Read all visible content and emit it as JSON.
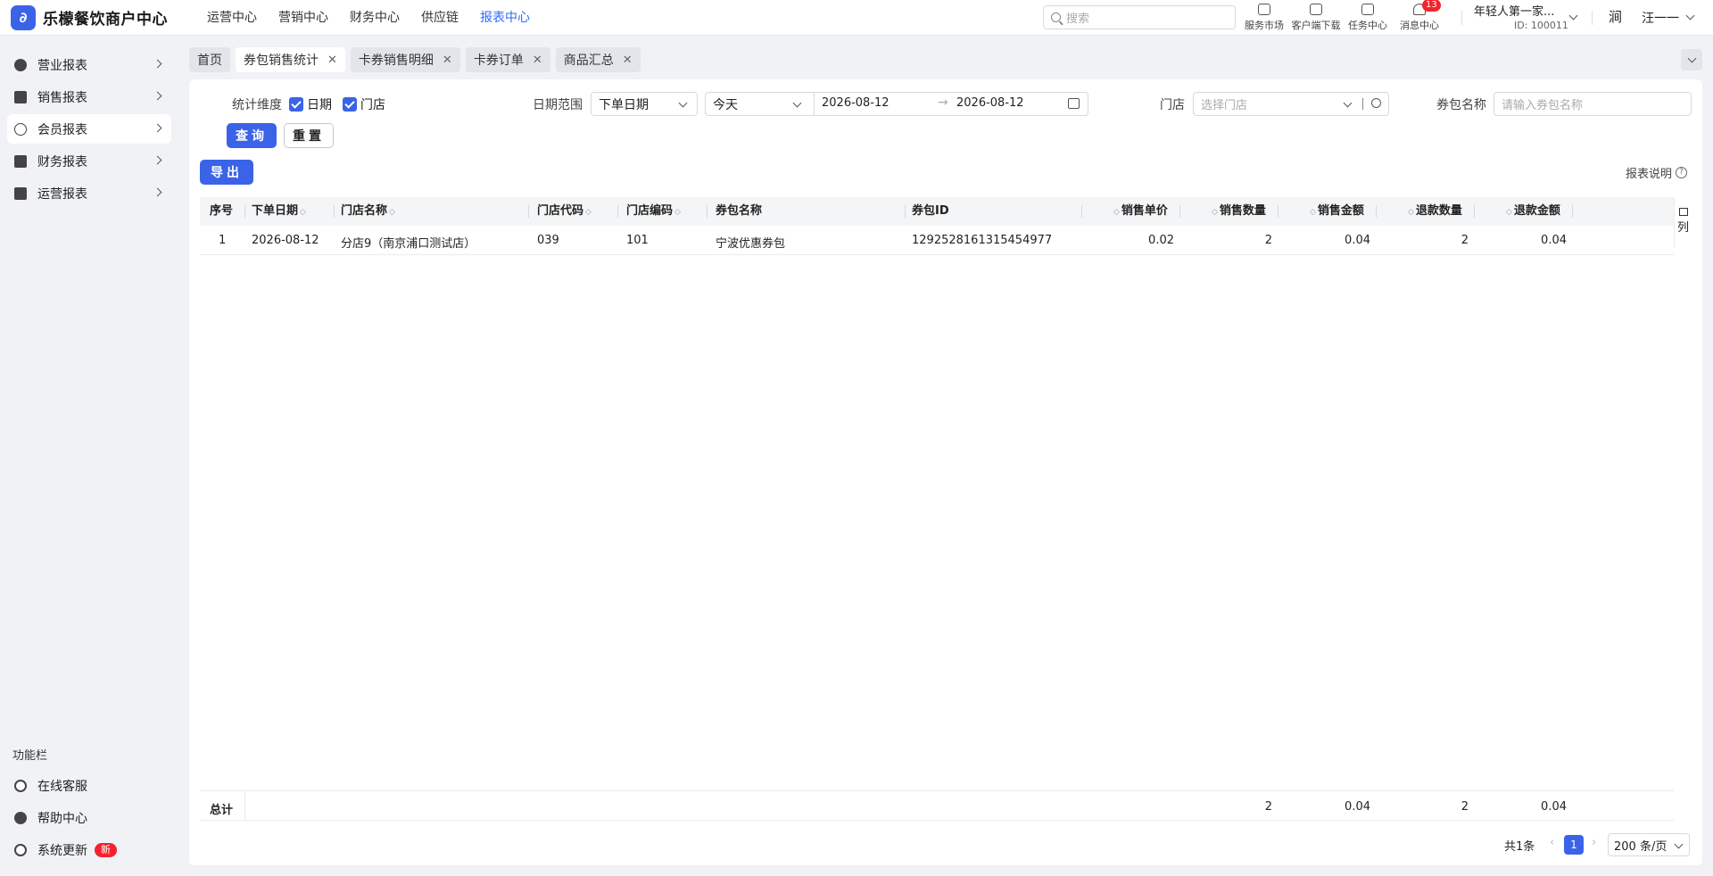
{
  "app": {
    "title": "乐檬餐饮商户中心",
    "logo_glyph": "∂",
    "accent": "#3b63e8"
  },
  "topnav": [
    {
      "label": "运营中心",
      "active": false
    },
    {
      "label": "营销中心",
      "active": false
    },
    {
      "label": "财务中心",
      "active": false
    },
    {
      "label": "供应链",
      "active": false
    },
    {
      "label": "报表中心",
      "active": true
    }
  ],
  "search": {
    "placeholder": "搜索"
  },
  "tools": {
    "market": "服务市场",
    "download": "客户端下载",
    "tasks": "任务中心",
    "messages": "消息中心",
    "messages_badge": "13"
  },
  "user": {
    "store": "年轻人第一家...",
    "id": "ID: 100011",
    "avatar_glyph": "涧",
    "name": "汪一一"
  },
  "sidebar": {
    "items": [
      {
        "label": "营业报表",
        "icon": "globe-icon"
      },
      {
        "label": "销售报表",
        "icon": "bank-icon"
      },
      {
        "label": "会员报表",
        "icon": "user-icon"
      },
      {
        "label": "财务报表",
        "icon": "receipt-icon"
      },
      {
        "label": "运营报表",
        "icon": "briefcase-icon"
      }
    ],
    "section_title": "功能栏",
    "footer": [
      {
        "label": "在线客服",
        "icon": "headset-icon"
      },
      {
        "label": "帮助中心",
        "icon": "help-icon"
      },
      {
        "label": "系统更新",
        "icon": "refresh-icon",
        "badge": "新"
      }
    ]
  },
  "tabs": [
    {
      "label": "首页",
      "closable": false
    },
    {
      "label": "券包销售统计",
      "closable": true,
      "active": true
    },
    {
      "label": "卡券销售明细",
      "closable": true
    },
    {
      "label": "卡券订单",
      "closable": true
    },
    {
      "label": "商品汇总",
      "closable": true
    }
  ],
  "filters": {
    "dimension_label": "统计维度",
    "dim_date": "日期",
    "dim_store": "门店",
    "date_range_label": "日期范围",
    "date_type": "下单日期",
    "preset": "今天",
    "start": "2026-08-12",
    "arrow": "→",
    "end": "2026-08-12",
    "store_label": "门店",
    "store_placeholder": "选择门店",
    "package_label": "券包名称",
    "package_placeholder": "请输入券包名称",
    "query": "查询",
    "reset": "重置"
  },
  "actions": {
    "export": "导出",
    "report_note": "报表说明"
  },
  "table": {
    "columns": [
      "序号",
      "下单日期",
      "门店名称",
      "门店代码",
      "门店编码",
      "券包名称",
      "券包ID",
      "销售单价",
      "销售数量",
      "销售金额",
      "退款数量",
      "退款金额"
    ],
    "rows": [
      [
        "1",
        "2026-08-12",
        "分店9（南京浦口测试店）",
        "039",
        "101",
        "宁波优惠券包",
        "1292528161315454977",
        "0.02",
        "2",
        "0.04",
        "2",
        "0.04"
      ]
    ],
    "total_label": "总计",
    "totals": {
      "sales_qty": "2",
      "sales_amt": "0.04",
      "refund_qty": "2",
      "refund_amt": "0.04"
    },
    "column_config": "列"
  },
  "pagination": {
    "total": "共1条",
    "current": "1",
    "page_size": "200 条/页"
  }
}
